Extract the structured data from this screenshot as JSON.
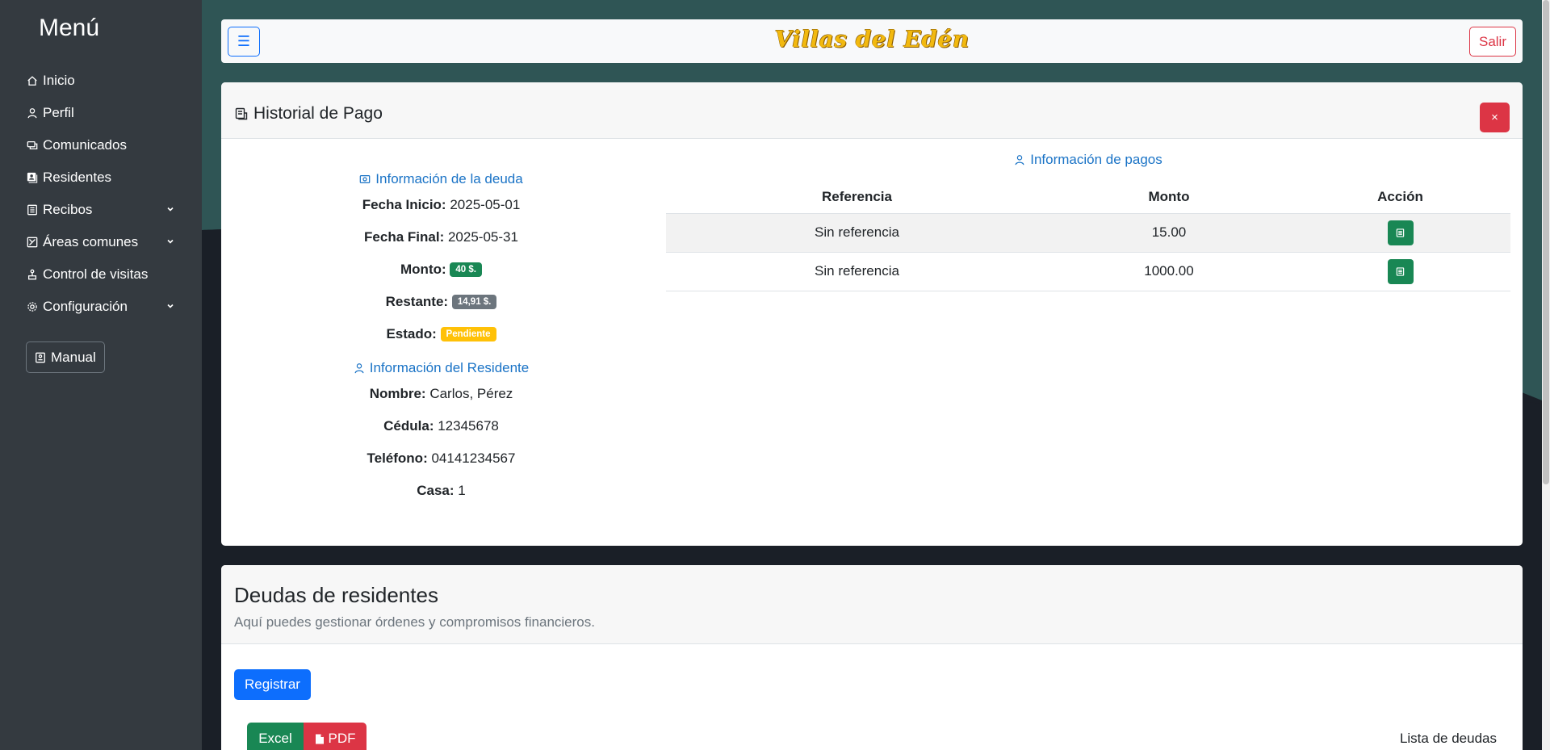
{
  "sidebar": {
    "title": "Menú",
    "items": [
      {
        "label": "Inicio",
        "icon": "home-icon"
      },
      {
        "label": "Perfil",
        "icon": "user-icon"
      },
      {
        "label": "Comunicados",
        "icon": "chat-icon"
      },
      {
        "label": "Residentes",
        "icon": "people-icon"
      },
      {
        "label": "Recibos",
        "icon": "receipt-icon"
      },
      {
        "label": "Áreas comunes",
        "icon": "area-icon"
      },
      {
        "label": "Control de visitas",
        "icon": "visit-icon"
      },
      {
        "label": "Configuración",
        "icon": "gear-icon"
      }
    ],
    "manual_label": "Manual"
  },
  "navbar": {
    "toggle_label": "☰",
    "brand": "Villas del Edén",
    "logout_label": "Salir"
  },
  "historial": {
    "title": "Historial de Pago",
    "close_label": "×",
    "deuda": {
      "heading": "Información de la deuda",
      "fecha_inicio_label": "Fecha Inicio:",
      "fecha_inicio": "2025-05-01",
      "fecha_final_label": "Fecha Final:",
      "fecha_final": "2025-05-31",
      "monto_label": "Monto:",
      "monto": "40 $.",
      "restante_label": "Restante:",
      "restante": "14,91 $.",
      "estado_label": "Estado:",
      "estado": "Pendiente"
    },
    "residente": {
      "heading": "Información del Residente",
      "nombre_label": "Nombre:",
      "nombre": "Carlos, Pérez",
      "cedula_label": "Cédula:",
      "cedula": "12345678",
      "telefono_label": "Teléfono:",
      "telefono": "04141234567",
      "casa_label": "Casa:",
      "casa": "1"
    },
    "pagos": {
      "heading": "Información de pagos",
      "columns": [
        "Referencia",
        "Monto",
        "Acción"
      ],
      "rows": [
        {
          "referencia": "Sin referencia",
          "monto": "15.00"
        },
        {
          "referencia": "Sin referencia",
          "monto": "1000.00"
        }
      ]
    }
  },
  "deudas": {
    "title": "Deudas de residentes",
    "subtitle": "Aquí puedes gestionar órdenes y compromisos financieros.",
    "register_label": "Registrar",
    "excel_label": "Excel",
    "pdf_label": "PDF",
    "list_label": "Lista de deudas"
  },
  "colors": {
    "sidebar_bg": "#343a40",
    "primary": "#0d6efd",
    "danger": "#dc3545",
    "success": "#198754",
    "warning": "#ffc107",
    "secondary": "#6c757d",
    "link": "#1a73c6",
    "brand": "#f2b90f"
  }
}
